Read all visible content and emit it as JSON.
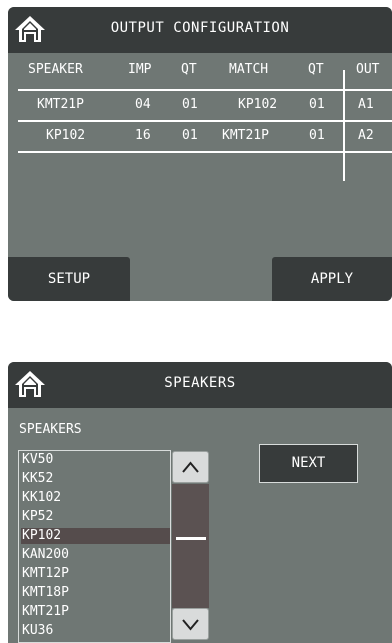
{
  "output_config": {
    "title": "OUTPUT CONFIGURATION",
    "headers": [
      "SPEAKER",
      "IMP",
      "QT",
      "MATCH",
      "QT",
      "OUT"
    ],
    "rows": [
      [
        "KMT21P",
        "04",
        "01",
        "KP102",
        "01",
        "A1"
      ],
      [
        "KP102",
        "16",
        "01",
        "KMT21P",
        "01",
        "A2"
      ]
    ],
    "setup_label": "SETUP",
    "apply_label": "APPLY"
  },
  "speakers_panel": {
    "title": "SPEAKERS",
    "list_label": "SPEAKERS",
    "items": [
      "KV50",
      "KK52",
      "KK102",
      "KP52",
      "KP102",
      "KAN200",
      "KMT12P",
      "KMT18P",
      "KMT21P",
      "KU36"
    ],
    "selected": "KP102",
    "next_label": "NEXT"
  },
  "icons": [
    "home-icon",
    "chevron-up-icon",
    "chevron-down-icon"
  ],
  "colors": {
    "panel": "#6f7774",
    "titlebar": "#373b3b",
    "selection": "#554c4c",
    "text": "#ffffff"
  }
}
